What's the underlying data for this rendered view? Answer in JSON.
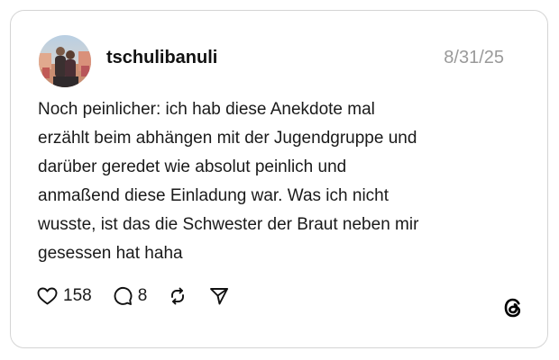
{
  "post": {
    "username": "tschulibanuli",
    "date": "8/31/25",
    "lines": [
      "Noch peinlicher: ich hab diese Anekdote mal",
      "erzählt beim abhängen mit der Jugendgruppe und",
      "darüber geredet wie absolut peinlich und",
      "anmaßend diese Einladung war. Was ich nicht",
      "wusste, ist das die Schwester der Braut neben mir",
      "gesessen hat haha"
    ]
  },
  "actions": {
    "likes": "158",
    "replies": "8",
    "icons": [
      "heart-icon",
      "comment-icon",
      "repost-icon",
      "share-icon"
    ]
  },
  "brand": {
    "logo": "threads-logo-icon"
  }
}
